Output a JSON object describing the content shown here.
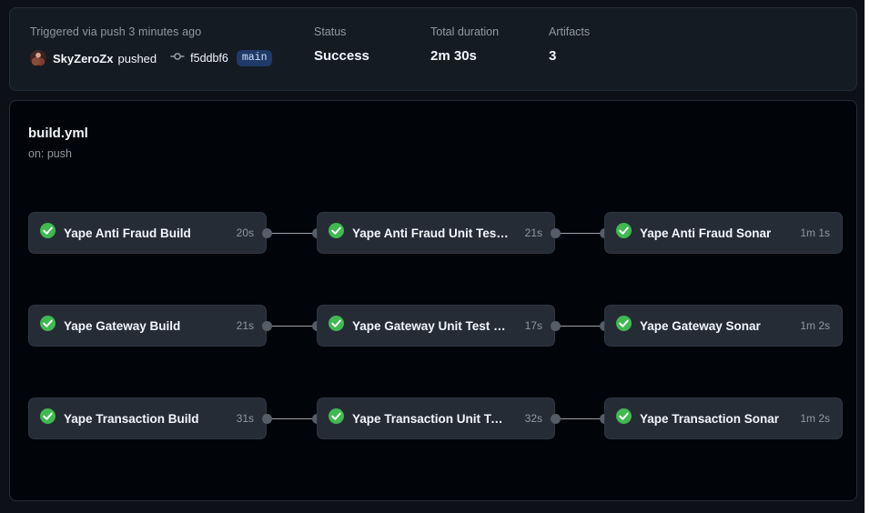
{
  "summary": {
    "trigger_text": "Triggered via push 3 minutes ago",
    "actor": "SkyZeroZx",
    "action_word": "pushed",
    "commit_sha": "f5ddbf6",
    "branch": "main",
    "avatar_icon": "user-avatar",
    "commit_icon": "git-commit-icon",
    "stats": [
      {
        "label": "Status",
        "value": "Success"
      },
      {
        "label": "Total duration",
        "value": "2m 30s"
      },
      {
        "label": "Artifacts",
        "value": "3"
      }
    ]
  },
  "workflow": {
    "title": "build.yml",
    "subtitle": "on: push",
    "rows": [
      {
        "jobs": [
          {
            "name": "Yape Anti Fraud Build",
            "duration": "20s",
            "status_icon": "check-circle-icon"
          },
          {
            "name": "Yape Anti Fraud Unit Test Jest",
            "duration": "21s",
            "status_icon": "check-circle-icon"
          },
          {
            "name": "Yape Anti Fraud Sonar",
            "duration": "1m 1s",
            "status_icon": "check-circle-icon"
          }
        ]
      },
      {
        "jobs": [
          {
            "name": "Yape Gateway Build",
            "duration": "21s",
            "status_icon": "check-circle-icon"
          },
          {
            "name": "Yape Gateway Unit Test Jest",
            "duration": "17s",
            "status_icon": "check-circle-icon"
          },
          {
            "name": "Yape Gateway Sonar",
            "duration": "1m 2s",
            "status_icon": "check-circle-icon"
          }
        ]
      },
      {
        "jobs": [
          {
            "name": "Yape Transaction Build",
            "duration": "31s",
            "status_icon": "check-circle-icon"
          },
          {
            "name": "Yape Transaction Unit Test J...",
            "duration": "32s",
            "status_icon": "check-circle-icon"
          },
          {
            "name": "Yape Transaction Sonar",
            "duration": "1m 2s",
            "status_icon": "check-circle-icon"
          }
        ]
      }
    ]
  },
  "colors": {
    "page_background": "#0d1117",
    "card_background": "#151b23",
    "graph_background": "#010409",
    "node_background": "#262c36",
    "border": "#262c36",
    "success_green": "#3fb950",
    "text_primary": "#f0f6fc",
    "text_muted": "#9198a1",
    "branch_badge_bg": "#1f3a68",
    "branch_badge_text": "#cfe0fb",
    "connector": "#545d68"
  }
}
